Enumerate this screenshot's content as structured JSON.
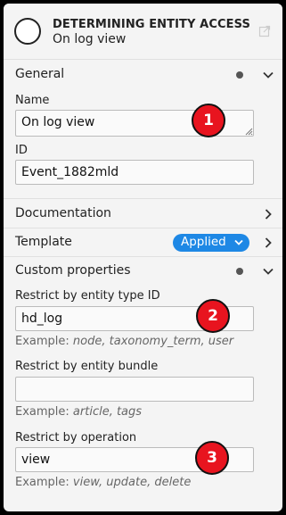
{
  "header": {
    "title": "DETERMINING ENTITY ACCESS",
    "subtitle": "On log view"
  },
  "general": {
    "title": "General",
    "name_label": "Name",
    "name_value": "On log view",
    "id_label": "ID",
    "id_value": "Event_1882mld"
  },
  "documentation": {
    "title": "Documentation"
  },
  "template": {
    "title": "Template",
    "badge": "Applied"
  },
  "custom": {
    "title": "Custom properties",
    "entity_type_label": "Restrict by entity type ID",
    "entity_type_value": "hd_log",
    "entity_type_hint_prefix": "Example:",
    "entity_type_hint": "node, taxonomy_term, user",
    "bundle_label": "Restrict by entity bundle",
    "bundle_value": "",
    "bundle_hint_prefix": "Example:",
    "bundle_hint": "article, tags",
    "operation_label": "Restrict by operation",
    "operation_value": "view",
    "operation_hint_prefix": "Example:",
    "operation_hint": "view, update, delete"
  },
  "markers": [
    "1",
    "2",
    "3"
  ],
  "colors": {
    "badge": "#1e88e5",
    "marker": "#e8141f"
  },
  "icons": [
    "circle-event-icon",
    "external-link-icon",
    "chevron-down-icon",
    "chevron-right-icon"
  ]
}
